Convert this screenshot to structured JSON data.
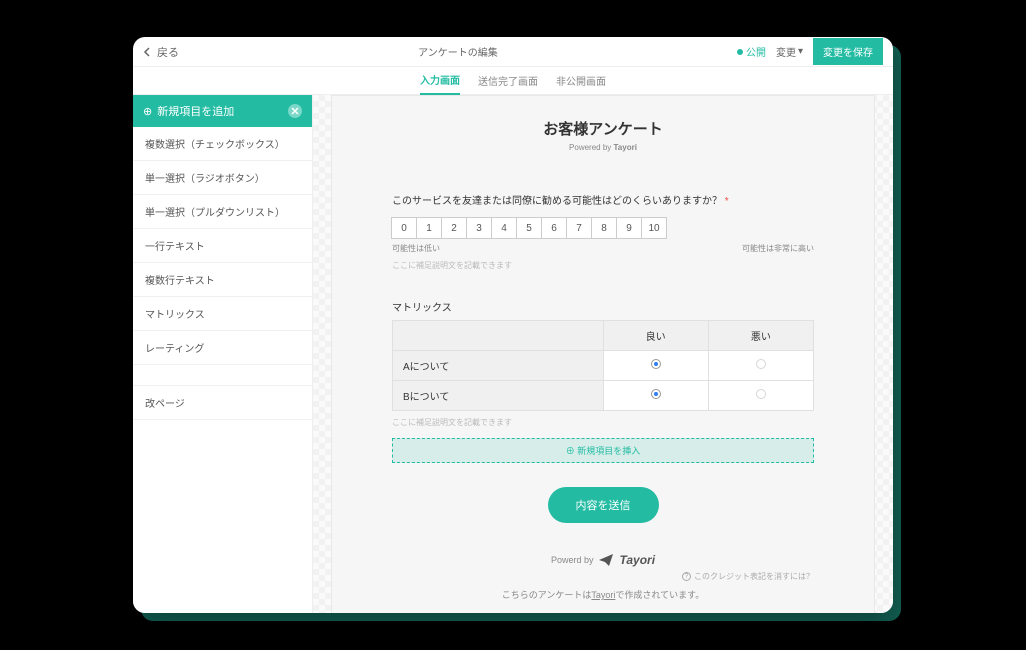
{
  "topbar": {
    "back": "戻る",
    "title": "アンケートの編集",
    "publish_status": "公開",
    "change": "変更",
    "save": "変更を保存"
  },
  "tabs": {
    "input": "入力画面",
    "complete": "送信完了画面",
    "private": "非公開画面"
  },
  "sidebar": {
    "header": "新規項目を追加",
    "items": {
      "checkbox": "複数選択（チェックボックス）",
      "radio": "単一選択（ラジオボタン）",
      "pulldown": "単一選択（プルダウンリスト）",
      "text": "一行テキスト",
      "textarea": "複数行テキスト",
      "matrix": "マトリックス",
      "rating": "レーティング",
      "pagebreak": "改ページ"
    }
  },
  "form": {
    "title": "お客様アンケート",
    "subtitle_prefix": "Powered by ",
    "subtitle_brand": "Tayori",
    "q1": {
      "label": "このサービスを友達または同僚に勧める可能性はどのくらいありますか？",
      "scale": [
        "0",
        "1",
        "2",
        "3",
        "4",
        "5",
        "6",
        "7",
        "8",
        "9",
        "10"
      ],
      "low": "可能性は低い",
      "high": "可能性は非常に高い",
      "hint": "ここに補足説明文を記載できます"
    },
    "q2": {
      "label": "マトリックス",
      "cols": {
        "good": "良い",
        "bad": "悪い"
      },
      "rows": {
        "a": "Aについて",
        "b": "Bについて"
      },
      "hint": "ここに補足説明文を記載できます"
    },
    "insert": "⊕ 新規項目を挿入",
    "submit": "内容を送信",
    "powered_prefix": "Powerd by",
    "credit_note": "このクレジット表記を消すには？",
    "footer_pre": "こちらのアンケートは",
    "footer_link": "Tayori",
    "footer_post": "で作成されています。"
  }
}
